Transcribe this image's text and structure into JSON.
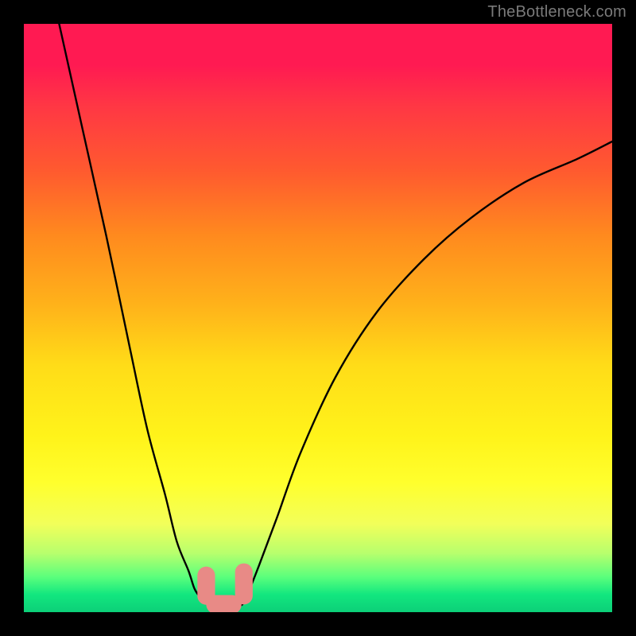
{
  "watermark": "TheBottleneck.com",
  "colors": {
    "curve": "#000000",
    "marker_fill": "#e88a86",
    "marker_stroke": "#c86a66",
    "gradient_top": "#ff1a52",
    "gradient_mid": "#fff31a",
    "gradient_bottom": "#0ccf78"
  },
  "chart_data": {
    "type": "line",
    "title": "",
    "xlabel": "",
    "ylabel": "",
    "xlim": [
      0,
      100
    ],
    "ylim": [
      0,
      100
    ],
    "grid": false,
    "legend": false,
    "series": [
      {
        "name": "left-branch",
        "x": [
          6,
          10,
          14,
          18,
          21,
          24,
          26,
          28,
          29,
          30,
          31,
          31.5
        ],
        "y": [
          100,
          82,
          64,
          45,
          31,
          20,
          12,
          7,
          4,
          2.5,
          1.6,
          1.2
        ]
      },
      {
        "name": "right-branch",
        "x": [
          37,
          38,
          40,
          43,
          47,
          53,
          60,
          68,
          76,
          85,
          94,
          100
        ],
        "y": [
          1.2,
          3,
          8,
          16,
          27,
          40,
          51,
          60,
          67,
          73,
          77,
          80
        ]
      },
      {
        "name": "valley-floor",
        "x": [
          31.5,
          33,
          35,
          37
        ],
        "y": [
          1.2,
          0.9,
          0.9,
          1.2
        ]
      }
    ],
    "markers": [
      {
        "shape": "capsule-vertical",
        "cx": 31.0,
        "cy": 4.5,
        "w": 3.0,
        "h": 6.5
      },
      {
        "shape": "capsule-vertical",
        "cx": 37.4,
        "cy": 4.8,
        "w": 3.0,
        "h": 7.0
      },
      {
        "shape": "capsule-horizontal",
        "cx": 34.0,
        "cy": 1.3,
        "w": 6.0,
        "h": 3.2
      }
    ]
  }
}
